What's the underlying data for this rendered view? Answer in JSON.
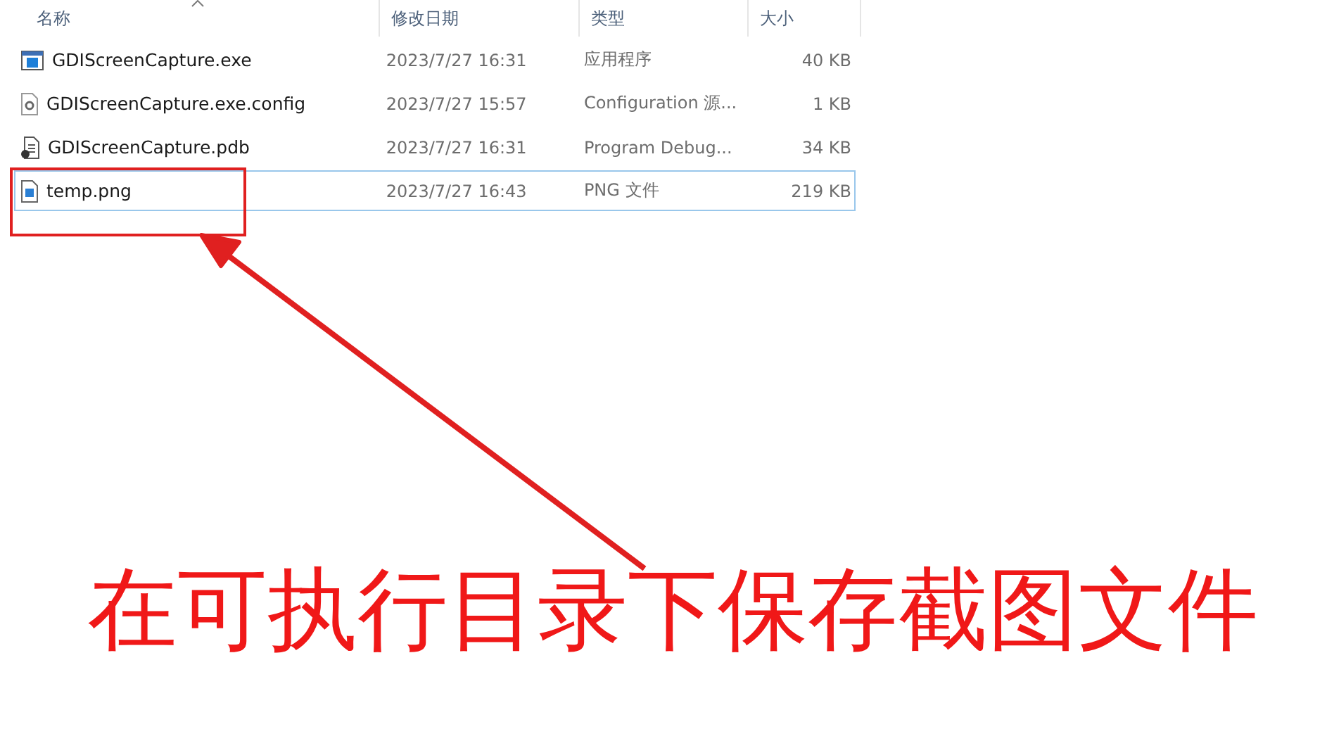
{
  "columns": [
    {
      "label": "名称",
      "sorted": true
    },
    {
      "label": "修改日期",
      "sorted": false
    },
    {
      "label": "类型",
      "sorted": false
    },
    {
      "label": "大小",
      "sorted": false
    }
  ],
  "files": [
    {
      "kind": "exe",
      "name": "GDIScreenCapture.exe",
      "date": "2023/7/27 16:31",
      "type": "应用程序",
      "size": "40 KB",
      "selected": false
    },
    {
      "kind": "config",
      "name": "GDIScreenCapture.exe.config",
      "date": "2023/7/27 15:57",
      "type": "Configuration 源...",
      "size": "1 KB",
      "selected": false
    },
    {
      "kind": "pdb",
      "name": "GDIScreenCapture.pdb",
      "date": "2023/7/27 16:31",
      "type": "Program Debug...",
      "size": "34 KB",
      "selected": false
    },
    {
      "kind": "png",
      "name": "temp.png",
      "date": "2023/7/27 16:43",
      "type": "PNG 文件",
      "size": "219 KB",
      "selected": true
    }
  ],
  "annotation": {
    "caption": "在可执行目录下保存截图文件"
  }
}
